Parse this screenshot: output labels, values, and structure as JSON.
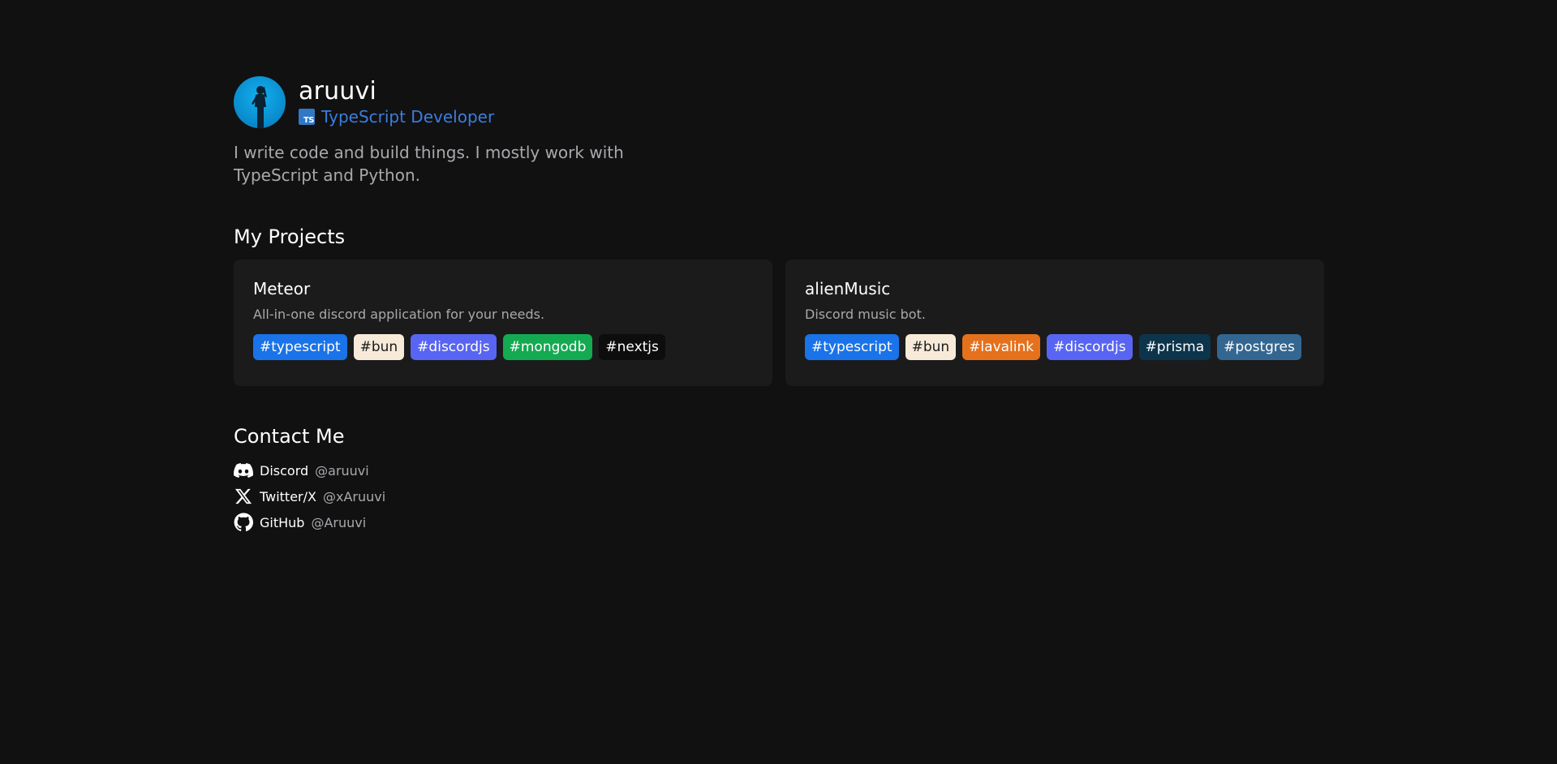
{
  "profile": {
    "name": "aruuvi",
    "role": "TypeScript Developer",
    "role_icon_text": "TS",
    "bio": "I write code and build things. I mostly work with TypeScript and Python."
  },
  "projects": {
    "title": "My Projects",
    "items": [
      {
        "name": "Meteor",
        "description": "All-in-one discord application for your needs.",
        "tags": [
          {
            "label": "#typescript",
            "bg": "#1a73e8",
            "fg": "#ffffff"
          },
          {
            "label": "#bun",
            "bg": "#f7ead8",
            "fg": "#1b1b1c"
          },
          {
            "label": "#discordjs",
            "bg": "#5865f2",
            "fg": "#ffffff"
          },
          {
            "label": "#mongodb",
            "bg": "#13aa52",
            "fg": "#ffffff"
          },
          {
            "label": "#nextjs",
            "bg": "#0d0d0d",
            "fg": "#ffffff"
          }
        ]
      },
      {
        "name": "alienMusic",
        "description": "Discord music bot.",
        "tags": [
          {
            "label": "#typescript",
            "bg": "#1a73e8",
            "fg": "#ffffff"
          },
          {
            "label": "#bun",
            "bg": "#f7ead8",
            "fg": "#1b1b1c"
          },
          {
            "label": "#lavalink",
            "bg": "#e5711d",
            "fg": "#ffffff"
          },
          {
            "label": "#discordjs",
            "bg": "#5865f2",
            "fg": "#ffffff"
          },
          {
            "label": "#prisma",
            "bg": "#0c344b",
            "fg": "#ffffff"
          },
          {
            "label": "#postgres",
            "bg": "#336791",
            "fg": "#ffffff"
          }
        ]
      }
    ]
  },
  "contact": {
    "title": "Contact Me",
    "items": [
      {
        "icon": "discord-icon",
        "platform": "Discord",
        "handle": "@aruuvi"
      },
      {
        "icon": "x-twitter-icon",
        "platform": "Twitter/X",
        "handle": "@xAruuvi"
      },
      {
        "icon": "github-icon",
        "platform": "GitHub",
        "handle": "@Aruuvi"
      }
    ]
  },
  "colors": {
    "background": "#111112",
    "card": "#1b1b1c",
    "accent": "#3b7ddd",
    "muted_text": "#a9a9ad"
  }
}
